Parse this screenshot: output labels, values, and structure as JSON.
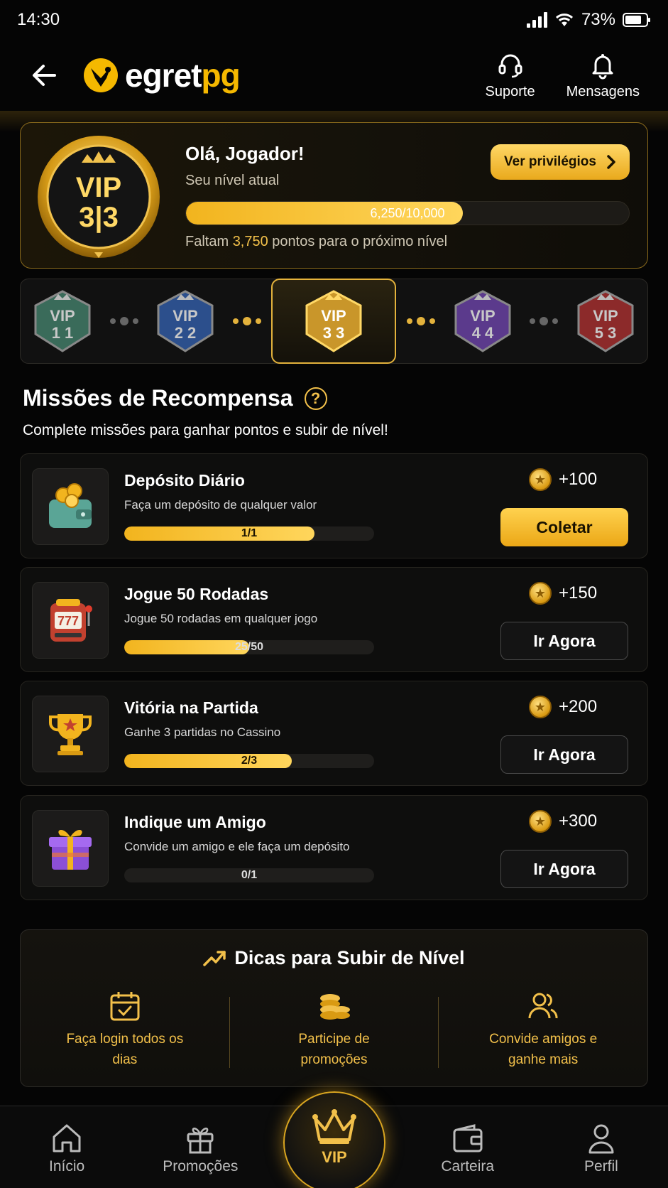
{
  "status_bar": {
    "time": "14:30",
    "battery": "73%"
  },
  "header": {
    "logo_text_a": "egret",
    "logo_text_b": "pg",
    "support_label": "Suporte",
    "messages_label": "Mensagens"
  },
  "hero": {
    "greeting": "Olá, Jogador!",
    "subtitle": "Seu nível atual",
    "button_label": "Ver privilégios",
    "progress_text": "6,250/10,000",
    "progress_fraction": 0.625,
    "remaining_prefix": "Faltam ",
    "remaining_points": "3,750",
    "remaining_suffix": " pontos para o próximo nível",
    "badge_top": "VIP",
    "badge_bottom": "3|3"
  },
  "levels": [
    {
      "top": "VIP",
      "bottom": "1 1",
      "color": "#3a6b5a"
    },
    {
      "top": "VIP",
      "bottom": "2 2",
      "color": "#2c4f8c"
    },
    {
      "top": "VIP",
      "bottom": "3 3",
      "color": "#c9962a"
    },
    {
      "top": "VIP",
      "bottom": "4 4",
      "color": "#5b3a8c"
    },
    {
      "top": "VIP",
      "bottom": "5 3",
      "color": "#8c2a2a"
    }
  ],
  "missions_section": {
    "title": "Missões de Recompensa",
    "help": "?",
    "subtitle": "Complete missões para ganhar pontos e subir de nível!"
  },
  "missions": [
    {
      "title": "Depósito Diário",
      "desc": "Faça um depósito de qualquer valor",
      "progress_text": "1/1",
      "progress": 0.76,
      "reward": "+100",
      "button": "Coletar"
    },
    {
      "title": "Jogue 50 Rodadas",
      "desc": "Jogue 50 rodadas em qualquer jogo",
      "progress_text": "25/50",
      "progress": 0.5,
      "reward": "+150",
      "button": "Ir Agora"
    },
    {
      "title": "Vitória na Partida",
      "desc": "Ganhe 3 partidas no Cassino",
      "progress_text": "2/3",
      "progress": 0.67,
      "reward": "+200",
      "button": "Ir Agora"
    },
    {
      "title": "Indique um Amigo",
      "desc": "Convide um amigo e ele faça um depósito",
      "progress_text": "0/1",
      "progress": 0,
      "reward": "+300",
      "button": "Ir Agora"
    }
  ],
  "tips": {
    "title": "Dicas para Subir de Nível",
    "items": [
      {
        "text": "Faça login todos os dias"
      },
      {
        "text": "Participe de promoções"
      },
      {
        "text": "Convide amigos e ganhe mais"
      }
    ]
  },
  "nav": {
    "home": "Início",
    "promos": "Promoções",
    "vip": "VIP",
    "wallet": "Carteira",
    "profile": "Perfil"
  },
  "colors": {
    "gold": "#f2c04a",
    "background": "#050505"
  }
}
